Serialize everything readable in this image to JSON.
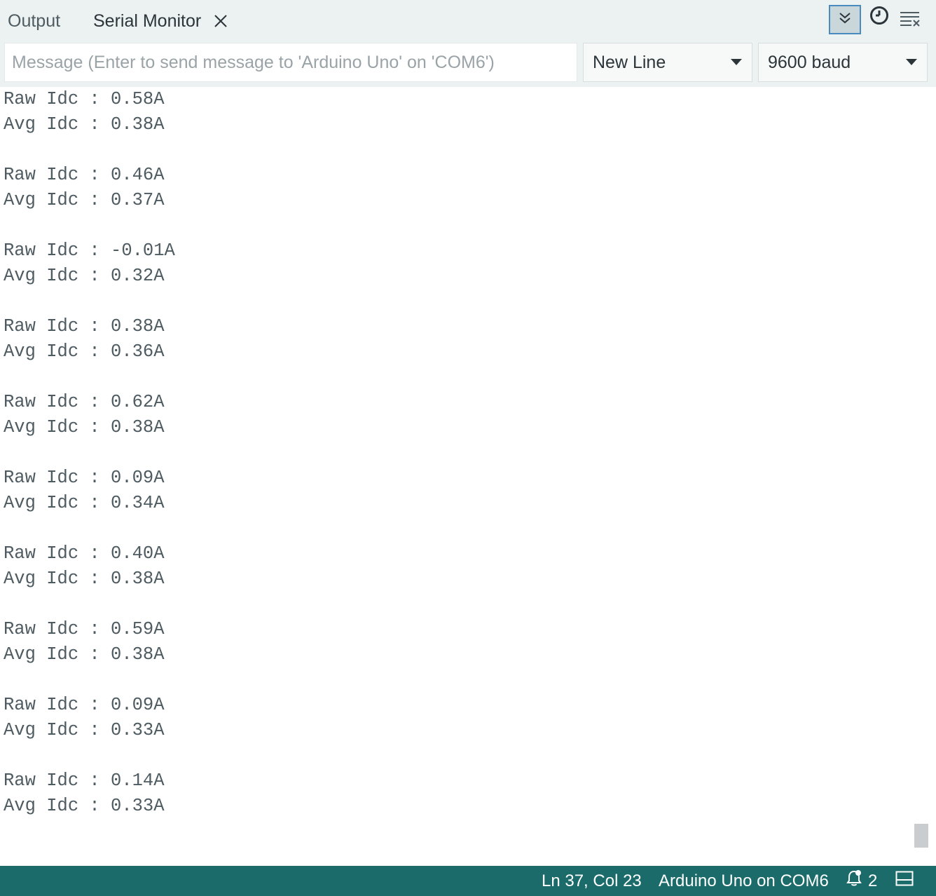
{
  "tabs": {
    "output_label": "Output",
    "serial_label": "Serial Monitor"
  },
  "toolbar": {
    "icons": [
      "autoscroll-icon",
      "clock-icon",
      "clear-output-icon"
    ]
  },
  "message": {
    "placeholder": "Message (Enter to send message to 'Arduino Uno' on 'COM6')",
    "value": ""
  },
  "line_ending": {
    "selected": "New Line"
  },
  "baud_rate": {
    "selected": "9600 baud"
  },
  "output_lines": [
    "Raw Idc : 0.58A",
    "Avg Idc : 0.38A",
    "",
    "Raw Idc : 0.46A",
    "Avg Idc : 0.37A",
    "",
    "Raw Idc : -0.01A",
    "Avg Idc : 0.32A",
    "",
    "Raw Idc : 0.38A",
    "Avg Idc : 0.36A",
    "",
    "Raw Idc : 0.62A",
    "Avg Idc : 0.38A",
    "",
    "Raw Idc : 0.09A",
    "Avg Idc : 0.34A",
    "",
    "Raw Idc : 0.40A",
    "Avg Idc : 0.38A",
    "",
    "Raw Idc : 0.59A",
    "Avg Idc : 0.38A",
    "",
    "Raw Idc : 0.09A",
    "Avg Idc : 0.33A",
    "",
    "Raw Idc : 0.14A",
    "Avg Idc : 0.33A"
  ],
  "status": {
    "cursor_position": "Ln 37, Col 23",
    "board": "Arduino Uno on COM6",
    "notification_count": "2"
  },
  "colors": {
    "status_bar": "#1b6b6b",
    "tab_bar": "#ecf1f1",
    "autoscroll_border": "#4a8bbf"
  }
}
